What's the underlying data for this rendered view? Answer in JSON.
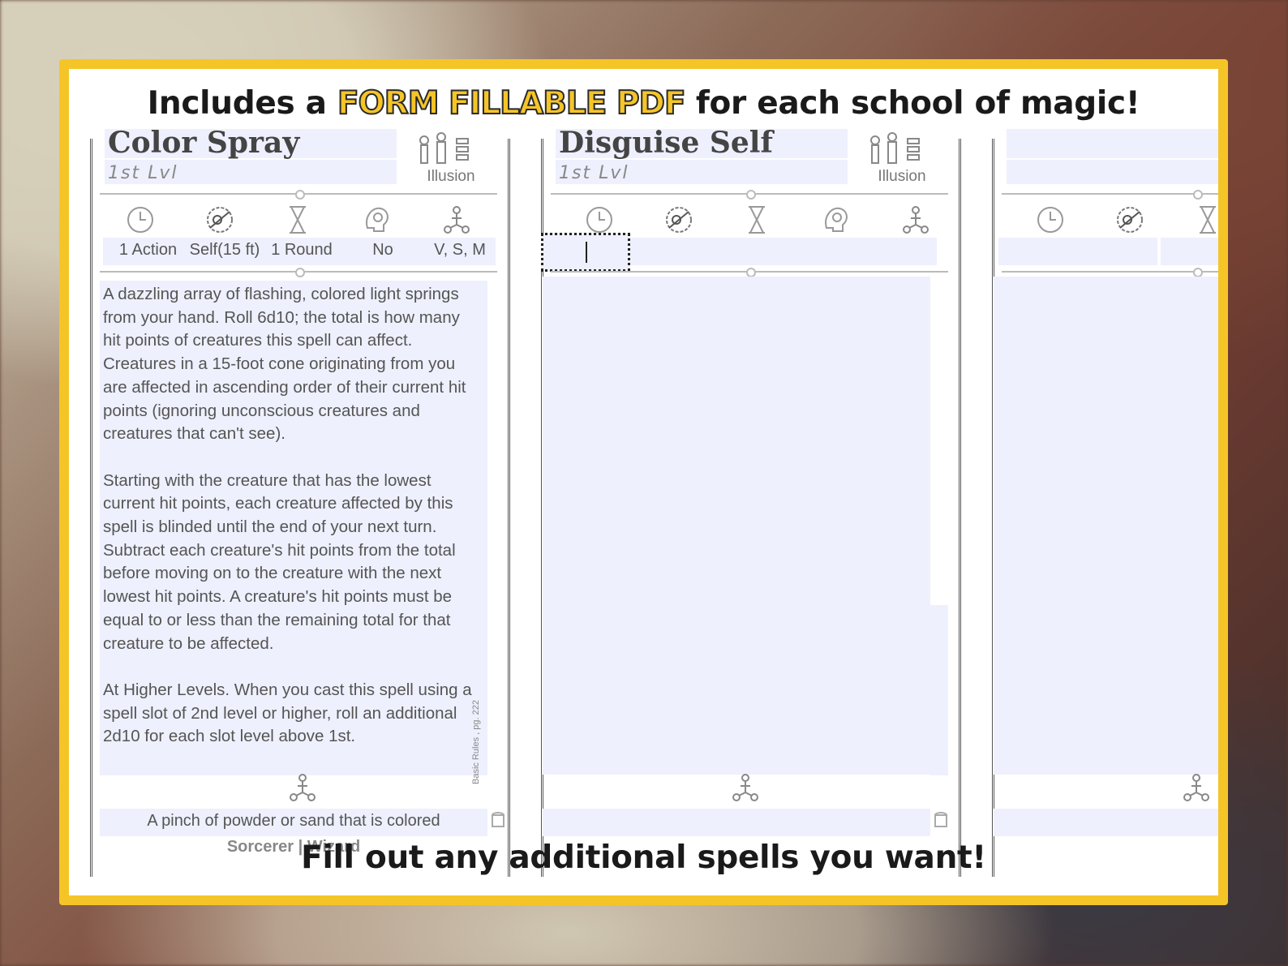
{
  "banner": {
    "headline_pre": "Includes a ",
    "headline_highlight": "FORM FILLABLE PDF",
    "headline_post": " for each school of magic!",
    "footline": "Fill out any additional spells you want!"
  },
  "colors": {
    "frame": "#f5c528",
    "field_fill": "#eef0fd",
    "text": "#1a1a1a"
  },
  "cards": [
    {
      "title": "Color Spray",
      "level": "1st Lvl",
      "school": "Illusion",
      "stats": {
        "casting_time": "1 Action",
        "range": "Self(15 ft)",
        "duration": "1 Round",
        "concentration": "No",
        "components": "V, S, M"
      },
      "description": "A dazzling array of flashing, colored light springs\nfrom your hand. Roll 6d10; the total is how many\nhit points of creatures this spell can affect.\nCreatures in a 15-foot cone originating from you\nare affected in ascending order of their current hit\npoints (ignoring unconscious creatures and\ncreatures that can't see).\n\nStarting with the creature that has the lowest\ncurrent hit points, each creature affected by this\nspell is blinded until the end of your next turn.\nSubtract each creature's hit points from the total\nbefore moving on to the creature with the next\nlowest hit points. A creature's hit points must be\nequal to or less than the remaining total for that\ncreature to be affected.\n\nAt Higher Levels. When you cast this spell using a\nspell slot of 2nd level or higher, roll an additional\n2d10 for each slot level above 1st.",
      "material": "A pinch of powder or sand that is colored",
      "classes": "Sorcerer | Wizard",
      "source": "Basic Rules , pg. 222"
    },
    {
      "title": "Disguise Self",
      "level": "1st Lvl",
      "school": "Illusion"
    }
  ],
  "icons": [
    "clock-icon",
    "range-icon",
    "hourglass-icon",
    "concentration-icon",
    "components-icon",
    "school-illusion-icon",
    "scroll-icon"
  ]
}
